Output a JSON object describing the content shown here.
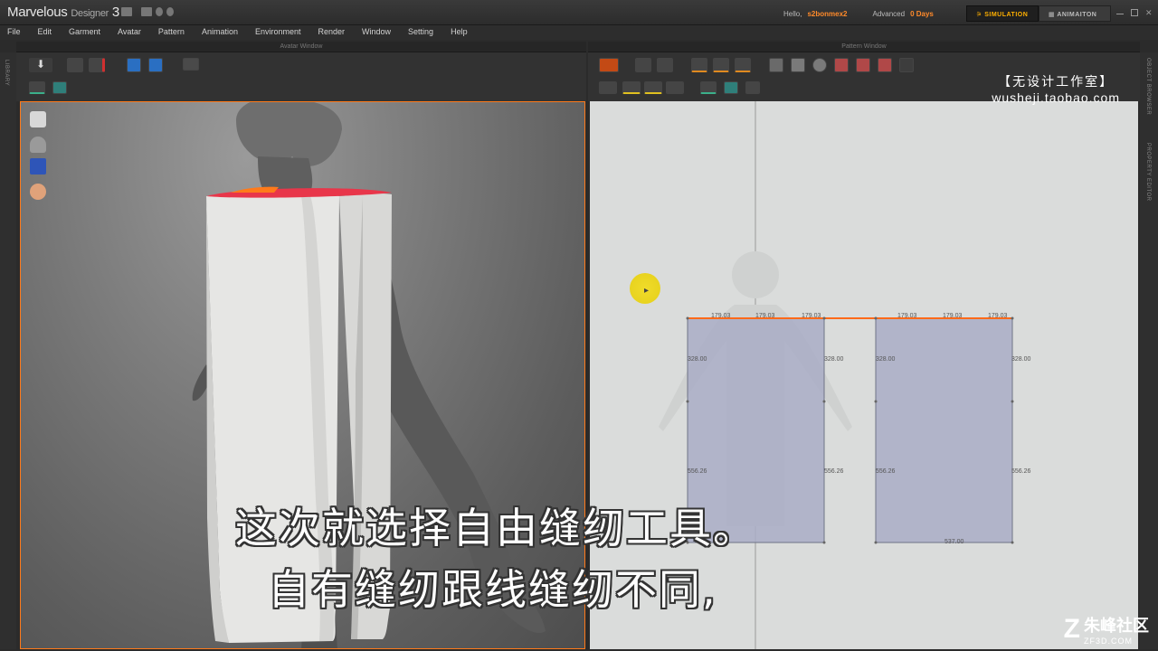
{
  "app": {
    "name": "Marvelous",
    "name_sub": "Designer",
    "version": "3"
  },
  "user": {
    "hello_label": "Hello,",
    "username": "s2bonmex2",
    "license_type": "Advanced",
    "days_left": "0 Days"
  },
  "modes": {
    "simulation": "SIMULATION",
    "animation": "ANIMAITON"
  },
  "menu": [
    "File",
    "Edit",
    "Garment",
    "Avatar",
    "Pattern",
    "Animation",
    "Environment",
    "Render",
    "Window",
    "Setting",
    "Help"
  ],
  "panels": {
    "avatar_window_title": "Avatar Window",
    "pattern_window_title": "Pattern Window"
  },
  "side_tabs": {
    "library": "LIBRARY",
    "object_browser": "OBJECT BROWSER",
    "property_editor": "PROPERTY EDITOR"
  },
  "pattern": {
    "top_measurements": [
      "179.03",
      "179.03",
      "179.03",
      "179.03",
      "179.03",
      "179.03"
    ],
    "side_measurements_upper": [
      "328.00",
      "328.00",
      "328.00",
      "328.00"
    ],
    "side_measurements_lower": [
      "556.26",
      "556.26",
      "556.26",
      "556.26"
    ],
    "bottom_measurement": "537.00"
  },
  "subtitles": {
    "line1": "这次就选择自由缝纫工具。",
    "line2": "自有缝纫跟线缝纫不同,"
  },
  "watermarks": {
    "top_cn": "【无设计工作室】",
    "top_url": "wusheji.taobao.com",
    "bottom_cn": "朱峰社区",
    "bottom_en": "ZF3D.COM"
  },
  "colors": {
    "accent_orange": "#ff7a1a",
    "simulation_yellow": "#ffb000",
    "pattern_fill": "#a9adc6",
    "seam_red": "#e8364a"
  }
}
